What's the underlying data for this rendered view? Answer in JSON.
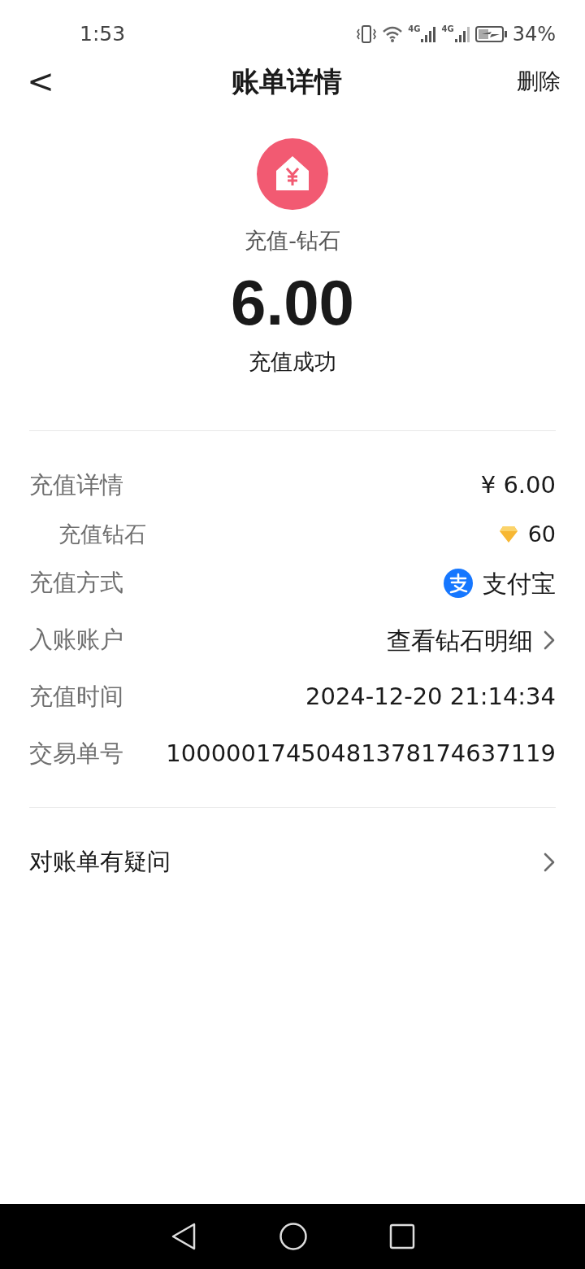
{
  "status_bar": {
    "time": "1:53",
    "network_labels": [
      "4G",
      "4G"
    ],
    "battery": "34%"
  },
  "header": {
    "back": "<",
    "title": "账单详情",
    "action": "删除"
  },
  "summary": {
    "title": "充值-钻石",
    "amount": "6.00",
    "status": "充值成功"
  },
  "details": [
    {
      "kind": "plain",
      "label": "充值详情",
      "value": "¥ 6.00"
    },
    {
      "kind": "diamond",
      "label": "充值钻石",
      "value": "60"
    },
    {
      "kind": "payment",
      "label": "充值方式",
      "value": "支付宝"
    },
    {
      "kind": "link",
      "label": "入账账户",
      "value": "查看钻石明细"
    },
    {
      "kind": "plain",
      "label": "充值时间",
      "value": "2024-12-20 21:14:34"
    },
    {
      "kind": "plain",
      "label": "交易单号",
      "value": "10000017450481378174637119"
    }
  ],
  "help": {
    "label": "对账单有疑问"
  }
}
